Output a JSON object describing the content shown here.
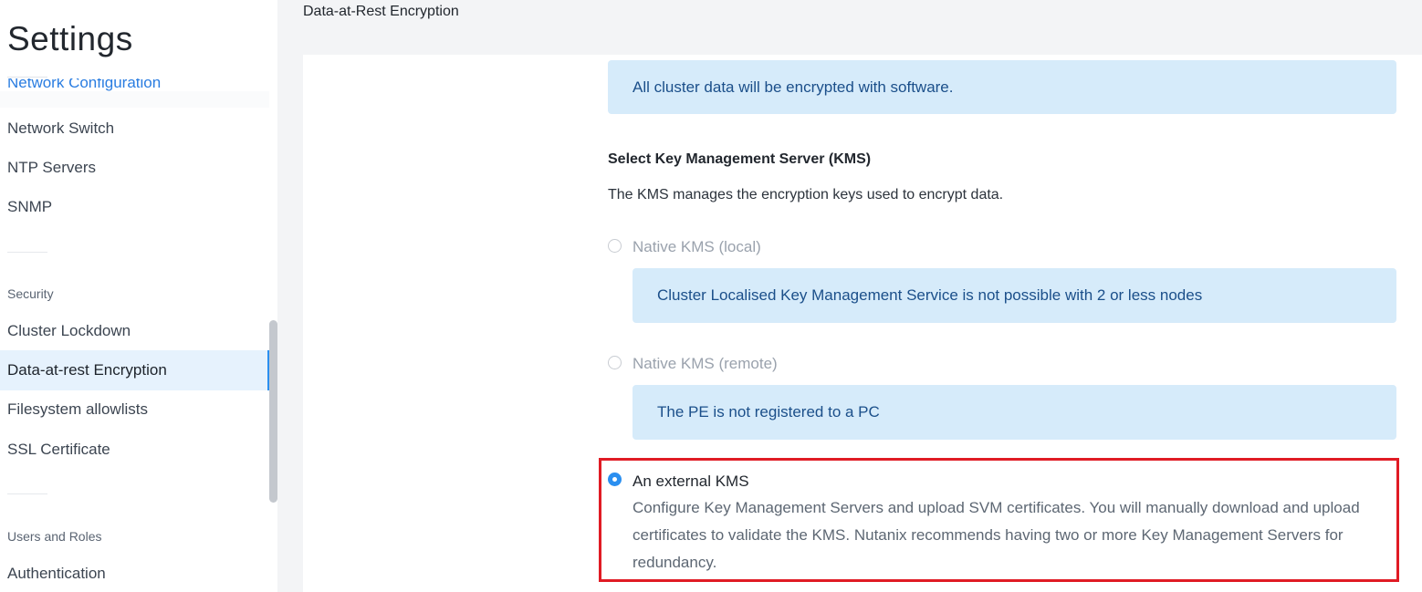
{
  "sidebar": {
    "title": "Settings",
    "partial_item": "Network Configuration",
    "items_network": [
      "Network Switch",
      "NTP Servers",
      "SNMP"
    ],
    "section_security": "Security",
    "items_security": [
      "Cluster Lockdown",
      "Data-at-rest Encryption",
      "Filesystem allowlists",
      "SSL Certificate"
    ],
    "section_users": "Users and Roles",
    "items_users": [
      "Authentication"
    ],
    "active_item": "Data-at-rest Encryption"
  },
  "main": {
    "header": "Data-at-Rest Encryption",
    "software_info": "All cluster data will be encrypted with software.",
    "kms_heading": "Select Key Management Server (KMS)",
    "kms_description": "The KMS manages the encryption keys used to encrypt data.",
    "options": [
      {
        "label": "Native KMS (local)",
        "enabled": false,
        "checked": false,
        "info": "Cluster Localised Key Management Service is not possible with 2 or less nodes"
      },
      {
        "label": "Native KMS (remote)",
        "enabled": false,
        "checked": false,
        "info": "The PE is not registered to a PC"
      },
      {
        "label": "An external KMS",
        "enabled": true,
        "checked": true,
        "description": "Configure Key Management Servers and upload SVM certificates. You will manually download and upload certificates to validate the KMS. Nutanix recommends having two or more Key Management Servers for redundancy."
      }
    ]
  },
  "colors": {
    "accent": "#2a8ff0",
    "info_bg": "#d6ebfa",
    "info_text": "#1b4f8a",
    "highlight": "#e01b24"
  }
}
